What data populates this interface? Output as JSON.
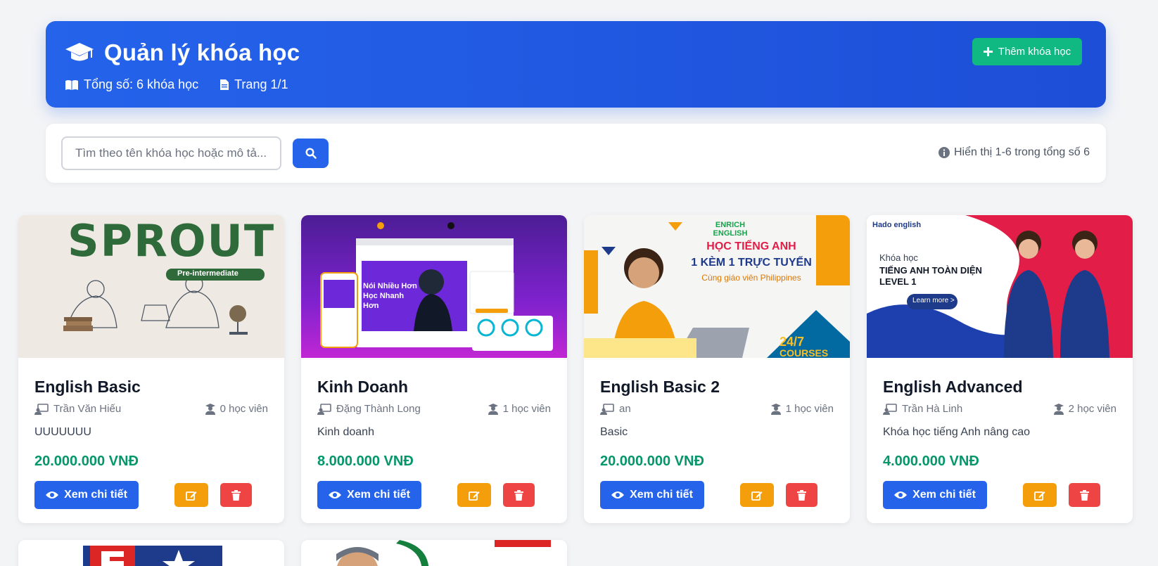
{
  "header": {
    "title": "Quản lý khóa học",
    "total": "Tổng số: 6 khóa học",
    "page": "Trang 1/1",
    "add_button": "Thêm khóa học"
  },
  "search": {
    "placeholder": "Tìm theo tên khóa học hoặc mô tả...",
    "result_info": "Hiển thị 1-6 trong tổng số 6"
  },
  "actions": {
    "view_label": "Xem chi tiết"
  },
  "courses": [
    {
      "name": "English Basic",
      "teacher": "Trần Văn Hiếu",
      "students": "0 học viên",
      "description": "UUUUUUU",
      "price": "20.000.000 VNĐ",
      "thumb_text": "SPROUT",
      "thumb_sub": "Pre-intermediate"
    },
    {
      "name": "Kinh Doanh",
      "teacher": "Đặng Thành Long",
      "students": "1 học viên",
      "description": "Kinh doanh",
      "price": "8.000.000 VNĐ",
      "thumb_text": "Nói Nhiều Hơn Học Nhanh Hơn"
    },
    {
      "name": "English Basic 2",
      "teacher": "an",
      "students": "1 học viên",
      "description": "Basic",
      "price": "20.000.000 VNĐ",
      "thumb_text": "HỌC TIẾNG ANH",
      "thumb_sub": "1 KÈM 1 TRỰC TUYẾN",
      "thumb_sub2": "Cùng giáo viên Philippines",
      "thumb_badge": "24/7",
      "thumb_badge2": "COURSES",
      "thumb_logo": "ENRICH ENGLISH"
    },
    {
      "name": "English Advanced",
      "teacher": "Trần Hà Linh",
      "students": "2 học viên",
      "description": "Khóa học tiếng Anh nâng cao",
      "price": "4.000.000 VNĐ",
      "thumb_logo": "Hado english",
      "thumb_text": "TIẾNG ANH TOÀN DIỆN LEVEL 1",
      "thumb_sub": "Khóa học",
      "thumb_button": "Learn more >"
    }
  ],
  "colors": {
    "primary": "#2563eb",
    "success": "#10b981",
    "price": "#059669",
    "warning": "#f59e0b",
    "danger": "#ef4444"
  }
}
